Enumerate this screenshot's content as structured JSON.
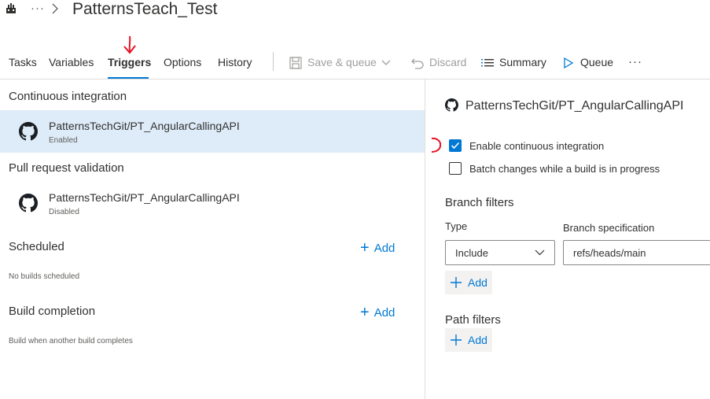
{
  "breadcrumb": {
    "more": "···",
    "title": "PatternsTeach_Test"
  },
  "tabs": [
    {
      "label": "Tasks"
    },
    {
      "label": "Variables"
    },
    {
      "label": "Triggers",
      "active": true
    },
    {
      "label": "Options"
    },
    {
      "label": "History"
    }
  ],
  "toolbar": {
    "save_queue": "Save & queue",
    "discard": "Discard",
    "summary": "Summary",
    "queue": "Queue",
    "more": "···"
  },
  "left": {
    "ci": {
      "title": "Continuous integration",
      "repo": "PatternsTechGit/PT_AngularCallingAPI",
      "status": "Enabled"
    },
    "pr": {
      "title": "Pull request validation",
      "repo": "PatternsTechGit/PT_AngularCallingAPI",
      "status": "Disabled"
    },
    "scheduled": {
      "title": "Scheduled",
      "add": "Add",
      "note": "No builds scheduled"
    },
    "build_completion": {
      "title": "Build completion",
      "add": "Add",
      "note": "Build when another build completes"
    }
  },
  "right": {
    "repo": "PatternsTechGit/PT_AngularCallingAPI",
    "enable_ci": {
      "label": "Enable continuous integration",
      "checked": true
    },
    "batch": {
      "label": "Batch changes while a build is in progress",
      "checked": false
    },
    "branch_filters": {
      "title": "Branch filters",
      "type_label": "Type",
      "spec_label": "Branch specification",
      "type_value": "Include",
      "spec_value": "refs/heads/main",
      "add": "Add"
    },
    "path_filters": {
      "title": "Path filters",
      "add": "Add"
    }
  },
  "colors": {
    "accent": "#0078d4",
    "selected_row": "#deecf9",
    "annotation": "#e81123"
  },
  "icons": [
    "pipeline-icon",
    "chevron-right-icon",
    "save-icon",
    "chevron-down-icon",
    "undo-icon",
    "list-icon",
    "play-icon",
    "github-icon",
    "plus-icon",
    "checkmark-icon",
    "red-arrow-annotation"
  ]
}
